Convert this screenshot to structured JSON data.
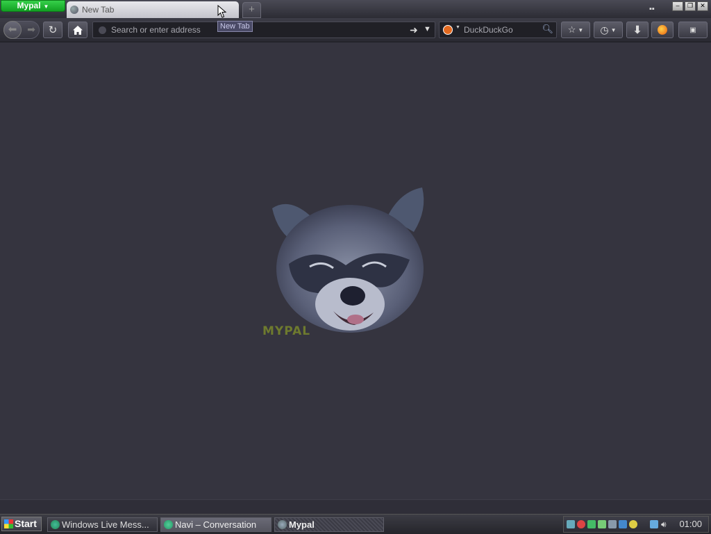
{
  "browser": {
    "app_menu_label": "Mypal",
    "tab": {
      "title": "New Tab"
    },
    "tooltip": "New Tab",
    "new_tab_symbol": "+",
    "window_controls": {
      "minimize": "–",
      "restore": "❐",
      "close": "✕"
    },
    "url_placeholder": "Search or enter address",
    "search_placeholder": "DuckDuckGo",
    "brand_text": "MYPAL",
    "icons": [
      "back-arrow-icon",
      "forward-arrow-icon",
      "reload-icon",
      "home-icon",
      "go-arrow-icon",
      "dropdown-icon",
      "duckduckgo-icon",
      "search-magnifier-icon",
      "bookmark-star-icon",
      "history-clock-icon",
      "download-icon",
      "firefox-icon",
      "addon-icon"
    ]
  },
  "taskbar": {
    "start_label": "Start",
    "tasks": [
      {
        "label": "Windows Live Mess..."
      },
      {
        "label": "Navi – Conversation"
      },
      {
        "label": "Mypal"
      }
    ],
    "clock": "01:00"
  }
}
